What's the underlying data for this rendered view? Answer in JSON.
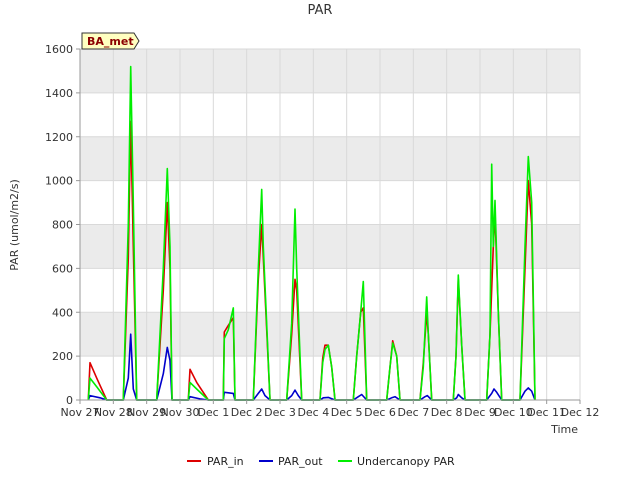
{
  "chart_data": {
    "type": "line",
    "title": "PAR",
    "xlabel": "Time",
    "ylabel": "PAR (umol/m2/s)",
    "badge": "BA_met",
    "ylim": [
      0,
      1600
    ],
    "xlim": [
      0,
      15
    ],
    "yticks": [
      0,
      200,
      400,
      600,
      800,
      1000,
      1200,
      1400,
      1600
    ],
    "xticks": [
      {
        "v": 0,
        "label": "Nov 27"
      },
      {
        "v": 1,
        "label": "Nov 28"
      },
      {
        "v": 2,
        "label": "Nov 29"
      },
      {
        "v": 3,
        "label": "Nov 30"
      },
      {
        "v": 4,
        "label": "Dec 1"
      },
      {
        "v": 5,
        "label": "Dec 2"
      },
      {
        "v": 6,
        "label": "Dec 3"
      },
      {
        "v": 7,
        "label": "Dec 4"
      },
      {
        "v": 8,
        "label": "Dec 5"
      },
      {
        "v": 9,
        "label": "Dec 6"
      },
      {
        "v": 10,
        "label": "Dec 7"
      },
      {
        "v": 11,
        "label": "Dec 8"
      },
      {
        "v": 12,
        "label": "Dec 9"
      },
      {
        "v": 13,
        "label": "Dec 10"
      },
      {
        "v": 14,
        "label": "Dec 11"
      },
      {
        "v": 15,
        "label": "Dec 12"
      }
    ],
    "grid": true,
    "legend_position": "bottom",
    "series": [
      {
        "name": "PAR_in",
        "color": "#dd0000",
        "points": [
          [
            0.25,
            0
          ],
          [
            0.3,
            170
          ],
          [
            0.5,
            100
          ],
          [
            0.8,
            0
          ],
          [
            1.3,
            0
          ],
          [
            1.45,
            650
          ],
          [
            1.52,
            1270
          ],
          [
            1.6,
            700
          ],
          [
            1.7,
            0
          ],
          [
            2.3,
            0
          ],
          [
            2.5,
            500
          ],
          [
            2.62,
            900
          ],
          [
            2.7,
            600
          ],
          [
            2.76,
            0
          ],
          [
            3.25,
            0
          ],
          [
            3.3,
            140
          ],
          [
            3.5,
            80
          ],
          [
            3.85,
            0
          ],
          [
            4.3,
            0
          ],
          [
            4.33,
            310
          ],
          [
            4.45,
            340
          ],
          [
            4.6,
            375
          ],
          [
            4.65,
            0
          ],
          [
            5.2,
            0
          ],
          [
            5.35,
            550
          ],
          [
            5.45,
            800
          ],
          [
            5.5,
            650
          ],
          [
            5.7,
            0
          ],
          [
            6.2,
            0
          ],
          [
            6.35,
            300
          ],
          [
            6.45,
            550
          ],
          [
            6.5,
            500
          ],
          [
            6.65,
            0
          ],
          [
            7.2,
            0
          ],
          [
            7.28,
            190
          ],
          [
            7.35,
            250
          ],
          [
            7.45,
            250
          ],
          [
            7.55,
            150
          ],
          [
            7.65,
            0
          ],
          [
            8.2,
            0
          ],
          [
            8.3,
            200
          ],
          [
            8.42,
            400
          ],
          [
            8.5,
            420
          ],
          [
            8.6,
            0
          ],
          [
            9.2,
            0
          ],
          [
            9.3,
            150
          ],
          [
            9.38,
            270
          ],
          [
            9.5,
            200
          ],
          [
            9.6,
            0
          ],
          [
            10.2,
            0
          ],
          [
            10.3,
            170
          ],
          [
            10.4,
            400
          ],
          [
            10.45,
            300
          ],
          [
            10.55,
            0
          ],
          [
            11.2,
            0
          ],
          [
            11.28,
            200
          ],
          [
            11.35,
            550
          ],
          [
            11.45,
            250
          ],
          [
            11.55,
            0
          ],
          [
            12.2,
            0
          ],
          [
            12.3,
            300
          ],
          [
            12.4,
            700
          ],
          [
            12.45,
            850
          ],
          [
            12.55,
            400
          ],
          [
            12.65,
            0
          ],
          [
            13.2,
            0
          ],
          [
            13.35,
            600
          ],
          [
            13.45,
            1000
          ],
          [
            13.55,
            800
          ],
          [
            13.65,
            0
          ]
        ]
      },
      {
        "name": "PAR_out",
        "color": "#0000cc",
        "points": [
          [
            0.25,
            0
          ],
          [
            0.3,
            20
          ],
          [
            0.6,
            10
          ],
          [
            0.8,
            0
          ],
          [
            1.3,
            0
          ],
          [
            1.45,
            100
          ],
          [
            1.52,
            300
          ],
          [
            1.6,
            50
          ],
          [
            1.7,
            0
          ],
          [
            2.3,
            0
          ],
          [
            2.5,
            120
          ],
          [
            2.62,
            240
          ],
          [
            2.7,
            180
          ],
          [
            2.76,
            0
          ],
          [
            3.25,
            0
          ],
          [
            3.3,
            15
          ],
          [
            3.6,
            5
          ],
          [
            3.85,
            0
          ],
          [
            4.3,
            0
          ],
          [
            4.33,
            35
          ],
          [
            4.6,
            30
          ],
          [
            4.65,
            0
          ],
          [
            5.2,
            0
          ],
          [
            5.35,
            30
          ],
          [
            5.45,
            50
          ],
          [
            5.55,
            20
          ],
          [
            5.7,
            0
          ],
          [
            6.2,
            0
          ],
          [
            6.35,
            20
          ],
          [
            6.45,
            45
          ],
          [
            6.55,
            20
          ],
          [
            6.65,
            0
          ],
          [
            7.2,
            0
          ],
          [
            7.3,
            10
          ],
          [
            7.45,
            12
          ],
          [
            7.65,
            0
          ],
          [
            8.2,
            0
          ],
          [
            8.35,
            15
          ],
          [
            8.45,
            25
          ],
          [
            8.6,
            0
          ],
          [
            9.2,
            0
          ],
          [
            9.35,
            10
          ],
          [
            9.45,
            15
          ],
          [
            9.6,
            0
          ],
          [
            10.2,
            0
          ],
          [
            10.35,
            15
          ],
          [
            10.42,
            20
          ],
          [
            10.55,
            0
          ],
          [
            11.2,
            0
          ],
          [
            11.3,
            10
          ],
          [
            11.35,
            25
          ],
          [
            11.45,
            10
          ],
          [
            11.55,
            0
          ],
          [
            12.2,
            0
          ],
          [
            12.35,
            30
          ],
          [
            12.42,
            50
          ],
          [
            12.5,
            35
          ],
          [
            12.65,
            0
          ],
          [
            13.2,
            0
          ],
          [
            13.35,
            40
          ],
          [
            13.45,
            55
          ],
          [
            13.55,
            40
          ],
          [
            13.65,
            0
          ]
        ]
      },
      {
        "name": "Undercanopy PAR",
        "color": "#00ee00",
        "points": [
          [
            0.25,
            0
          ],
          [
            0.3,
            100
          ],
          [
            0.5,
            60
          ],
          [
            0.8,
            0
          ],
          [
            1.3,
            0
          ],
          [
            1.45,
            800
          ],
          [
            1.52,
            1520
          ],
          [
            1.6,
            900
          ],
          [
            1.7,
            0
          ],
          [
            2.3,
            0
          ],
          [
            2.5,
            600
          ],
          [
            2.62,
            1055
          ],
          [
            2.7,
            700
          ],
          [
            2.76,
            0
          ],
          [
            3.25,
            0
          ],
          [
            3.3,
            80
          ],
          [
            3.5,
            50
          ],
          [
            3.85,
            0
          ],
          [
            4.3,
            0
          ],
          [
            4.33,
            280
          ],
          [
            4.45,
            320
          ],
          [
            4.6,
            420
          ],
          [
            4.65,
            0
          ],
          [
            5.2,
            0
          ],
          [
            5.35,
            600
          ],
          [
            5.45,
            960
          ],
          [
            5.5,
            700
          ],
          [
            5.7,
            0
          ],
          [
            6.2,
            0
          ],
          [
            6.35,
            350
          ],
          [
            6.45,
            870
          ],
          [
            6.5,
            600
          ],
          [
            6.65,
            0
          ],
          [
            7.2,
            0
          ],
          [
            7.28,
            170
          ],
          [
            7.35,
            230
          ],
          [
            7.45,
            250
          ],
          [
            7.55,
            150
          ],
          [
            7.65,
            0
          ],
          [
            8.2,
            0
          ],
          [
            8.3,
            200
          ],
          [
            8.42,
            400
          ],
          [
            8.5,
            540
          ],
          [
            8.6,
            0
          ],
          [
            9.2,
            0
          ],
          [
            9.3,
            150
          ],
          [
            9.38,
            260
          ],
          [
            9.5,
            200
          ],
          [
            9.6,
            0
          ],
          [
            10.2,
            0
          ],
          [
            10.3,
            150
          ],
          [
            10.4,
            470
          ],
          [
            10.45,
            300
          ],
          [
            10.55,
            0
          ],
          [
            11.2,
            0
          ],
          [
            11.28,
            200
          ],
          [
            11.35,
            570
          ],
          [
            11.45,
            250
          ],
          [
            11.55,
            0
          ],
          [
            12.2,
            0
          ],
          [
            12.3,
            300
          ],
          [
            12.35,
            1075
          ],
          [
            12.4,
            700
          ],
          [
            12.45,
            910
          ],
          [
            12.55,
            400
          ],
          [
            12.65,
            0
          ],
          [
            13.2,
            0
          ],
          [
            13.35,
            700
          ],
          [
            13.45,
            1110
          ],
          [
            13.55,
            900
          ],
          [
            13.65,
            0
          ]
        ]
      }
    ]
  }
}
